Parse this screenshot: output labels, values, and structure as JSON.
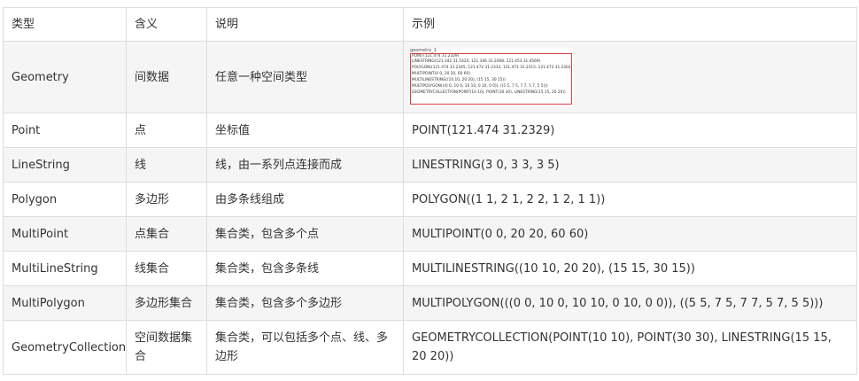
{
  "headers": [
    "类型",
    "含义",
    "说明",
    "示例"
  ],
  "rows": [
    {
      "type": "Geometry",
      "meaning": "间数据",
      "desc": "任意一种空间类型",
      "example": ""
    },
    {
      "type": "Point",
      "meaning": "点",
      "desc": "坐标值",
      "example": "POINT(121.474 31.2329)"
    },
    {
      "type": "LineString",
      "meaning": "线",
      "desc": "线，由一系列点连接而成",
      "example": "LINESTRING(3 0,  3 3, 3 5)"
    },
    {
      "type": "Polygon",
      "meaning": "多边形",
      "desc": "由多条线组成",
      "example": "POLYGON((1 1, 2 1, 2 2,  1 2, 1 1))"
    },
    {
      "type": "MultiPoint",
      "meaning": "点集合",
      "desc": "集合类，包含多个点",
      "example": "MULTIPOINT(0 0, 20 20, 60 60)"
    },
    {
      "type": "MultiLineString",
      "meaning": "线集合",
      "desc": "集合类，包含多条线",
      "example": "MULTILINESTRING((10 10, 20 20), (15 15, 30 15))"
    },
    {
      "type": "MultiPolygon",
      "meaning": "多边形集合",
      "desc": "集合类，包含多个多边形",
      "example": "MULTIPOLYGON(((0 0, 10 0, 10 10, 0 10, 0 0)), ((5 5, 7 5, 7 7, 5 7, 5 5)))"
    },
    {
      "type": "GeometryCollection",
      "meaning": "空间数据集合",
      "desc": "集合类，可以包括多个点、线、多边形",
      "example": "GEOMETRYCOLLECTION(POINT(10 10), POINT(30 30), LINESTRING(15 15, 20 20))"
    }
  ],
  "geometry_example_image": {
    "caption": "geometry_1",
    "lines": [
      "POINT(121.474 31.2329)",
      "LINESTRING(121.342 31.5424, 121.346 31.2468, 121.453 31.4569)",
      "POLYGON((121.474 31.2345, 121.472 31.2333, 121.471 31.2315, 121.472 31.2302, 121",
      "MULTIPOINT(0 0, 20 20, 60 60)",
      "MULTILINESTRING((10 10, 20 20), (15 15, 30 15))",
      "MULTIPOLYGON(((0 0, 10 0, 10 10, 0 10, 0 0)), ((5 5, 7 5, 7 7, 5 7, 5 5)))",
      "GEOMETRYCOLLECTION(POINT(10 10), POINT(30 30), LINESTRING(15 15, 20 20))"
    ]
  }
}
